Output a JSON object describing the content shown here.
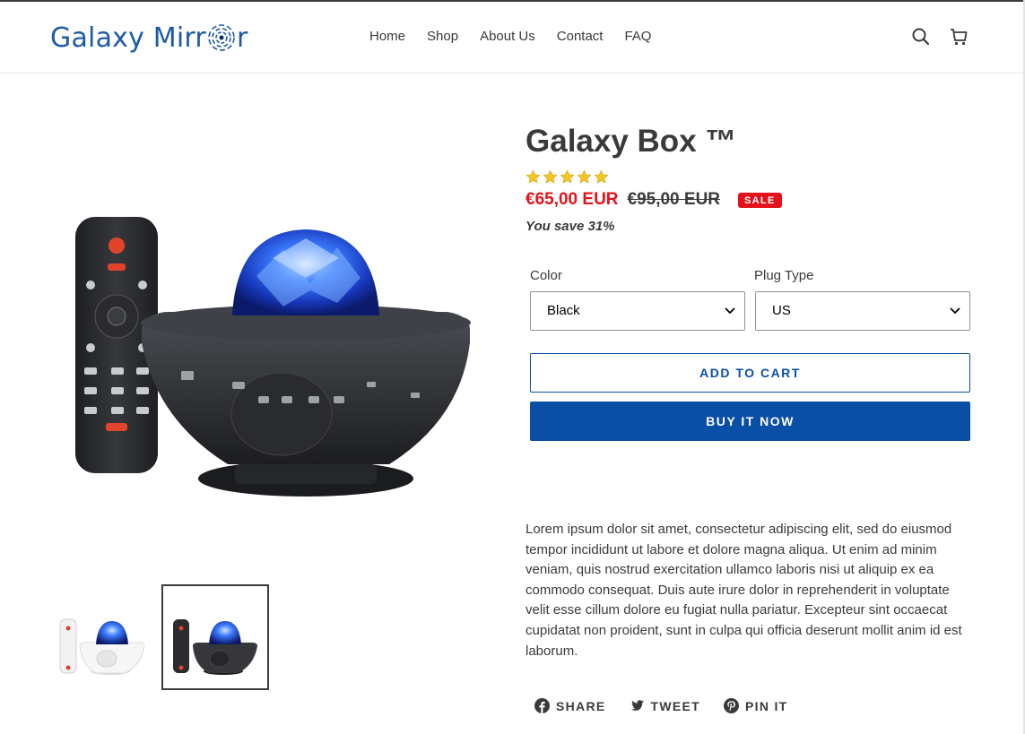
{
  "header": {
    "logo_text_left": "Galaxy Mirr",
    "logo_text_right": "r",
    "nav": [
      "Home",
      "Shop",
      "About Us",
      "Contact",
      "FAQ"
    ],
    "icons": [
      "search-icon",
      "cart-icon"
    ]
  },
  "product": {
    "title": "Galaxy Box ™",
    "rating_stars": 5,
    "price_sale": "€65,00 EUR",
    "price_original": "€95,00 EUR",
    "badge": "SALE",
    "savings": "You save 31%",
    "options": {
      "color_label": "Color",
      "color_value": "Black",
      "plug_label": "Plug Type",
      "plug_value": "US"
    },
    "add_to_cart": "ADD TO CART",
    "buy_now": "BUY IT NOW",
    "description": "Lorem ipsum dolor sit amet, consectetur adipiscing elit, sed do eiusmod tempor incididunt ut labore et dolore magna aliqua. Ut enim ad minim veniam, quis nostrud exercitation ullamco laboris nisi ut aliquip ex ea commodo consequat. Duis aute irure dolor in reprehenderit in voluptate velit esse cillum dolore eu fugiat nulla pariatur. Excepteur sint occaecat cupidatat non proident, sunt in culpa qui officia deserunt mollit anim id est laborum.",
    "share": {
      "facebook": "SHARE",
      "twitter": "TWEET",
      "pinterest": "PIN IT"
    }
  },
  "colors": {
    "brand_blue": "#0a4fa6",
    "sale_red": "#e3121b",
    "star_gold": "#f3c623",
    "text": "#3a3a3a"
  }
}
